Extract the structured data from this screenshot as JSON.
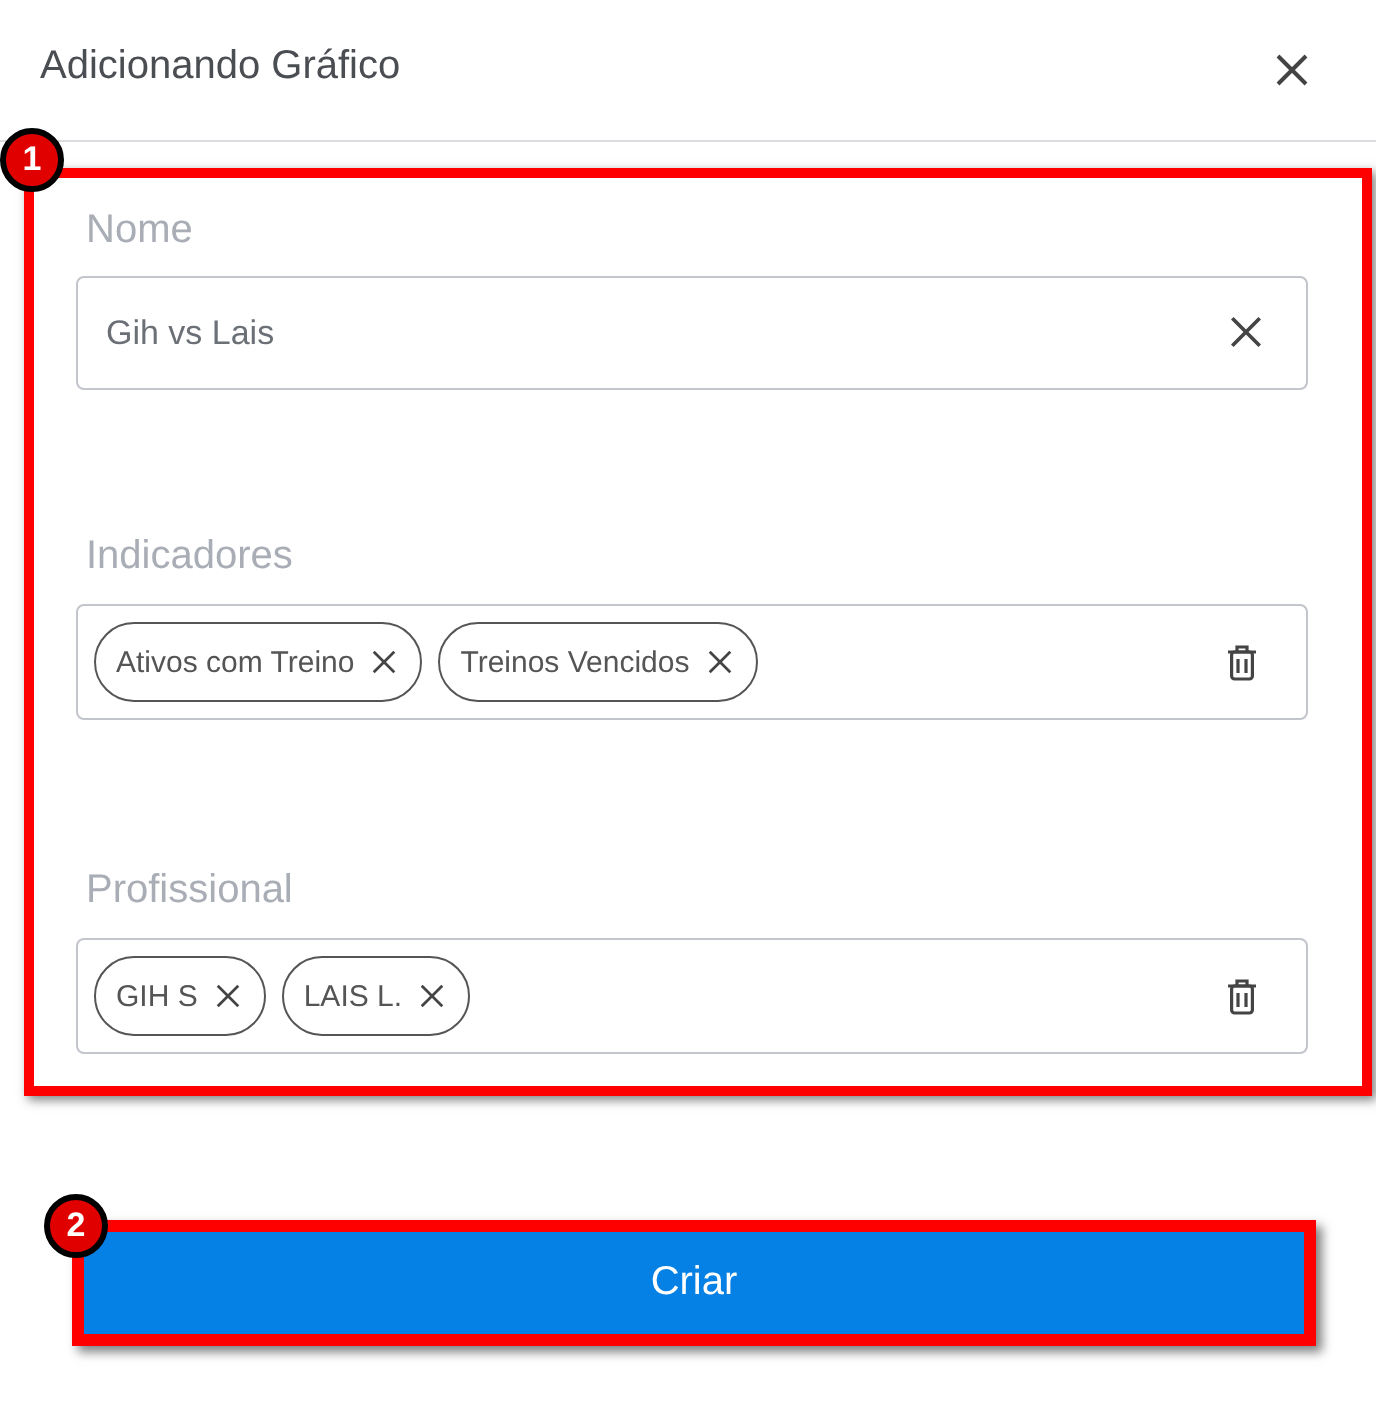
{
  "dialog": {
    "title": "Adicionando Gráfico"
  },
  "fields": [
    {
      "kind": "text",
      "label": "Nome",
      "value": "Gih vs Lais"
    },
    {
      "kind": "chips",
      "label": "Indicadores",
      "chips": [
        "Ativos com Treino",
        "Treinos Vencidos"
      ]
    },
    {
      "kind": "chips",
      "label": "Profissional",
      "chips": [
        "GIH S",
        "LAIS L."
      ]
    }
  ],
  "submit_button": "Criar",
  "annotations": [
    {
      "number": "1"
    },
    {
      "number": "2"
    }
  ]
}
